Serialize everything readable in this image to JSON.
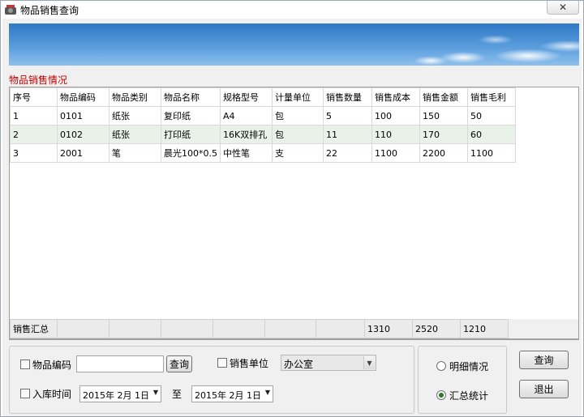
{
  "window": {
    "title": "物品销售查询",
    "close_glyph": "✕"
  },
  "section_label": "物品销售情况",
  "table": {
    "headers": [
      "序号",
      "物品编码",
      "物品类别",
      "物品名称",
      "规格型号",
      "计量单位",
      "销售数量",
      "销售成本",
      "销售金额",
      "销售毛利"
    ],
    "rows": [
      [
        "1",
        "0101",
        "纸张",
        "复印纸",
        "A4",
        "包",
        "5",
        "100",
        "150",
        "50"
      ],
      [
        "2",
        "0102",
        "纸张",
        "打印纸",
        "16K双排孔",
        "包",
        "11",
        "110",
        "170",
        "60"
      ],
      [
        "3",
        "2001",
        "笔",
        "晨光100*0.5",
        "中性笔",
        "支",
        "22",
        "1100",
        "2200",
        "1100"
      ]
    ],
    "summary": [
      "销售汇总",
      "",
      "",
      "",
      "",
      "",
      "",
      "1310",
      "2520",
      "1210"
    ]
  },
  "filters": {
    "item_code_label": "物品编码",
    "item_code_value": "",
    "query_small_label": "查询",
    "sales_unit_label": "销售单位",
    "sales_unit_value": "办公室",
    "date_label": "入库时间",
    "date_from": "2015年  2月  1日",
    "date_to_sep": "至",
    "date_to": "2015年  2月  1日"
  },
  "mode": {
    "detail_label": "明细情况",
    "summary_label": "汇总统计",
    "selected": "summary"
  },
  "actions": {
    "query_label": "查询",
    "exit_label": "退出"
  }
}
